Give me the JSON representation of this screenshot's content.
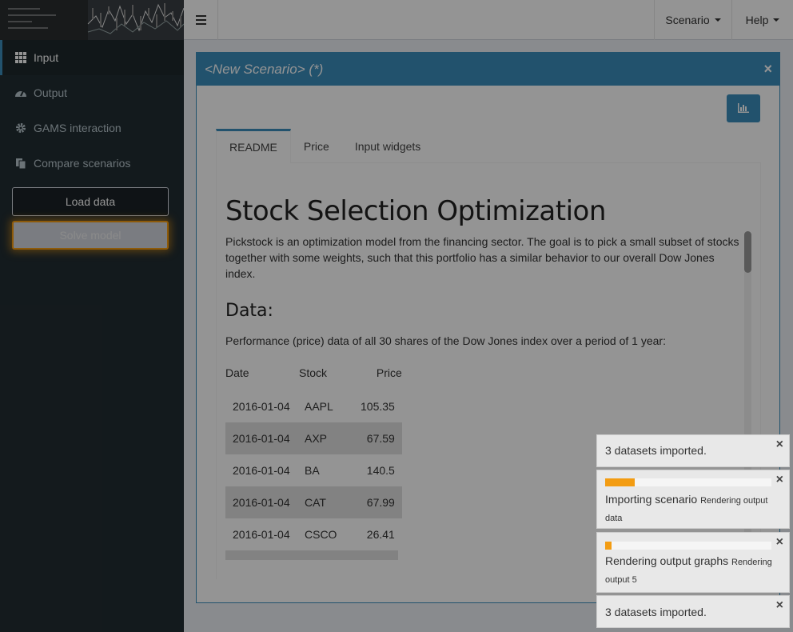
{
  "header": {
    "scenario_label": "Scenario",
    "help_label": "Help"
  },
  "sidebar": {
    "items": [
      {
        "label": "Input",
        "icon": "grid-icon"
      },
      {
        "label": "Output",
        "icon": "dashboard-icon"
      },
      {
        "label": "GAMS interaction",
        "icon": "gear-icon"
      },
      {
        "label": "Compare scenarios",
        "icon": "copy-icon"
      }
    ],
    "load_button": "Load data",
    "solve_button": "Solve model"
  },
  "box": {
    "title": "<New Scenario> (*)",
    "tabs": [
      "README",
      "Price",
      "Input widgets"
    ]
  },
  "readme": {
    "heading": "Stock Selection Optimization",
    "intro": "Pickstock is an optimization model from the financing sector. The goal is to pick a small subset of stocks together with some weights, such that this portfolio has a similar behavior to our overall Dow Jones index.",
    "data_heading": "Data:",
    "data_desc": "Performance (price) data of all 30 shares of the Dow Jones index over a period of 1 year:",
    "table": {
      "headers": [
        "Date",
        "Stock",
        "Price"
      ],
      "rows": [
        [
          "2016-01-04",
          "AAPL",
          "105.35"
        ],
        [
          "2016-01-04",
          "AXP",
          "67.59"
        ],
        [
          "2016-01-04",
          "BA",
          "140.5"
        ],
        [
          "2016-01-04",
          "CAT",
          "67.99"
        ],
        [
          "2016-01-04",
          "CSCO",
          "26.41"
        ]
      ]
    }
  },
  "notifications": [
    {
      "text": "3 datasets imported.",
      "sub": ""
    },
    {
      "text": "Importing scenario",
      "sub": "Rendering output data",
      "progress": 0.18
    },
    {
      "text": "Rendering output graphs",
      "sub": "Rendering output 5",
      "progress": 0.04
    },
    {
      "text": "3 datasets imported.",
      "sub": ""
    }
  ],
  "colors": {
    "accent": "#3c8dbc",
    "sidebar": "#222d32",
    "warning": "#f39c12"
  }
}
